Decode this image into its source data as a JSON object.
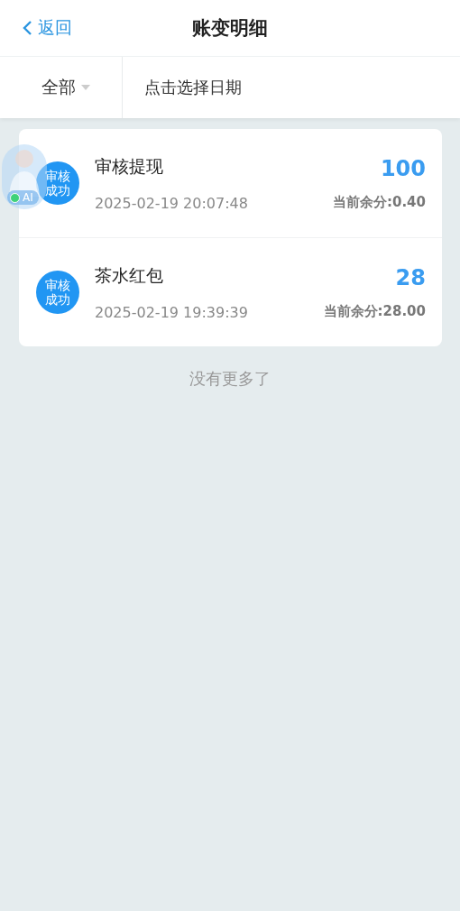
{
  "header": {
    "back": "返回",
    "title": "账变明细"
  },
  "filters": {
    "category": "全部",
    "date_placeholder": "点击选择日期"
  },
  "records": [
    {
      "badge": "审核成功",
      "title": "审核提现",
      "amount": "100",
      "time": "2025-02-19 20:07:48",
      "balance": "当前余分:0.40"
    },
    {
      "badge": "审核成功",
      "title": "茶水红包",
      "amount": "28",
      "time": "2025-02-19 19:39:39",
      "balance": "当前余分:28.00"
    }
  ],
  "end_note": "没有更多了",
  "assistant": {
    "label": "AI",
    "online": true
  }
}
